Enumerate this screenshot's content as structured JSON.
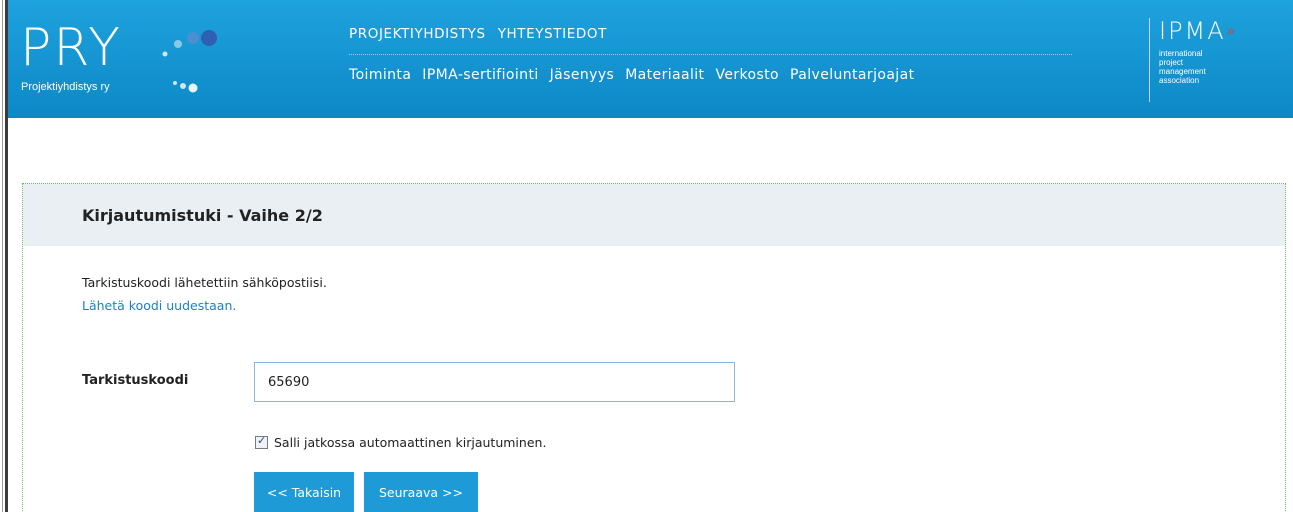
{
  "header": {
    "logo_text": "PRY",
    "logo_subtitle": "Projektiyhdistys ry",
    "top_links": [
      "PROJEKTIYHDISTYS",
      "YHTEYSTIEDOT"
    ],
    "main_links": [
      "Toiminta",
      "IPMA-sertifiointi",
      "Jäsenyys",
      "Materiaalit",
      "Verkosto",
      "Palveluntarjoajat"
    ],
    "ipma_word": "IPMA",
    "ipma_lines": [
      "international",
      "project",
      "management",
      "association"
    ],
    "brand_color": "#1ea2dd"
  },
  "panel": {
    "title": "Kirjautumistuki - Vaihe 2/2",
    "info_text": "Tarkistuskoodi lähetettiin sähköpostiisi.",
    "resend_link": "Lähetä koodi uudestaan.",
    "code_label": "Tarkistuskoodi",
    "code_value": "65690",
    "remember_label": "Salli jatkossa automaattinen kirjautuminen.",
    "remember_checked": true,
    "back_button": "<< Takaisin",
    "next_button": "Seuraava >>"
  }
}
